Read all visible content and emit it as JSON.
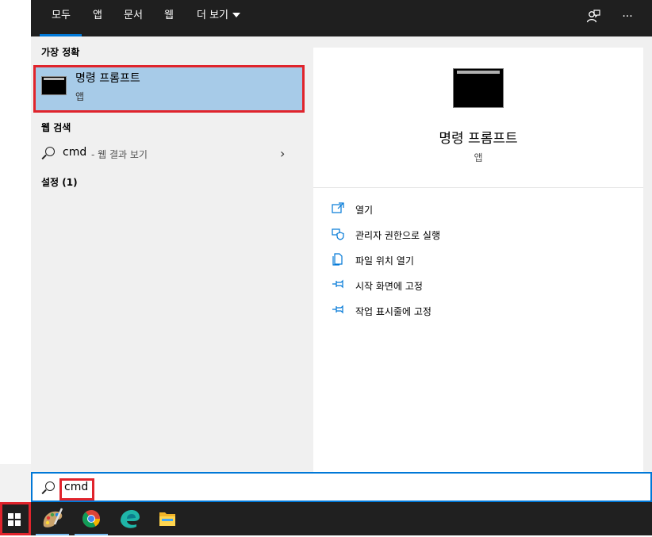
{
  "tabs": [
    {
      "label": "모두",
      "active": true
    },
    {
      "label": "앱"
    },
    {
      "label": "문서"
    },
    {
      "label": "웹"
    },
    {
      "label": "더 보기"
    }
  ],
  "header_icons": [
    "feedback-icon",
    "more-options-icon"
  ],
  "more_options_glyph": "···",
  "results": {
    "best_match_heading": "가장 정확",
    "best_match": {
      "title": "명령 프롬프트",
      "subtitle": "앱"
    },
    "web_search_heading": "웹 검색",
    "web_search": {
      "query": "cmd",
      "hint": "- 웹 결과 보기"
    },
    "settings_heading": "설정 (1)"
  },
  "preview": {
    "title": "명령 프롬프트",
    "subtitle": "앱",
    "actions": [
      {
        "label": "열기",
        "icon": "open-icon"
      },
      {
        "label": "관리자 권한으로 실행",
        "icon": "shield-icon"
      },
      {
        "label": "파일 위치 열기",
        "icon": "file-location-icon"
      },
      {
        "label": "시작 화면에 고정",
        "icon": "pin-icon"
      },
      {
        "label": "작업 표시줄에 고정",
        "icon": "pin-icon"
      }
    ]
  },
  "search": {
    "value": "cmd"
  },
  "taskbar": {
    "apps": [
      {
        "name": "paint-app-icon",
        "pinned_running": true
      },
      {
        "name": "chrome-app-icon",
        "pinned_running": true
      },
      {
        "name": "edge-app-icon",
        "pinned_running": false
      },
      {
        "name": "file-explorer-app-icon",
        "pinned_running": false
      }
    ]
  },
  "colors": {
    "accent": "#0078d7",
    "highlight": "#a7cbe8",
    "annotation": "#e0242c",
    "dark_bar": "#1f1f1f"
  }
}
